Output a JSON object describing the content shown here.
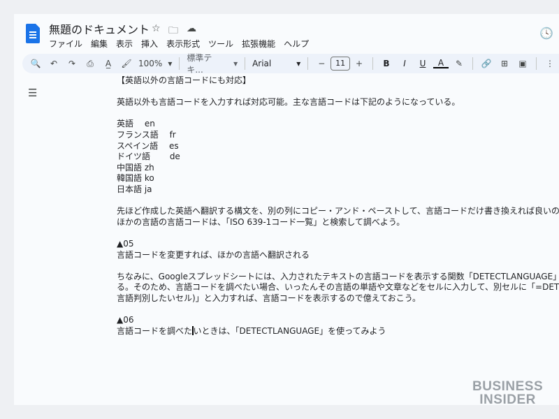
{
  "doc_title": "無題のドキュメント",
  "menu": [
    "ファイル",
    "編集",
    "表示",
    "挿入",
    "表示形式",
    "ツール",
    "拡張機能",
    "ヘルプ"
  ],
  "toolbar": {
    "zoom": "100%",
    "style": "標準テキ...",
    "font": "Arial",
    "font_size": "11"
  },
  "doc_lines": [
    "【英語以外の言語コードにも対応】",
    "",
    "英語以外も言語コードを入力すれば対応可能。主な言語コードは下記のようになっている。",
    "",
    "英語　 en",
    "フランス語　 fr",
    "スペイン語　 es",
    "ドイツ語　　 de",
    "中国語 zh",
    "韓国語 ko",
    "日本語 ja",
    "",
    "先ほど作成した英語へ翻訳する構文を、別の列にコピー・アンド・ペーストして、言語コードだけ書き換えれば良いのだ。",
    "ほかの言語の言語コードは、「ISO 639-1コード一覧」と検索して調べよう。",
    "",
    "▲05",
    "言語コードを変更すれば、ほかの言語へ翻訳される",
    "",
    "ちなみに、Googleスプレッドシートには、入力されたテキストの言語コードを表示する関数「DETECTLANGUAGE」も",
    "る。そのため、言語コードを調べたい場合、いったんその言語の単語や文章などをセルに入力して、別セルに「=DETE",
    "言語判別したいセル)」と入力すれば、言語コードを表示するので億えておこう。",
    "",
    "▲06"
  ],
  "last_line_before_cursor": "言語コードを調べた",
  "last_line_after_cursor": "いときは、「DETECTLANGUAGE」を使ってみよう",
  "watermark": [
    "BUSINESS",
    "INSIDER"
  ]
}
